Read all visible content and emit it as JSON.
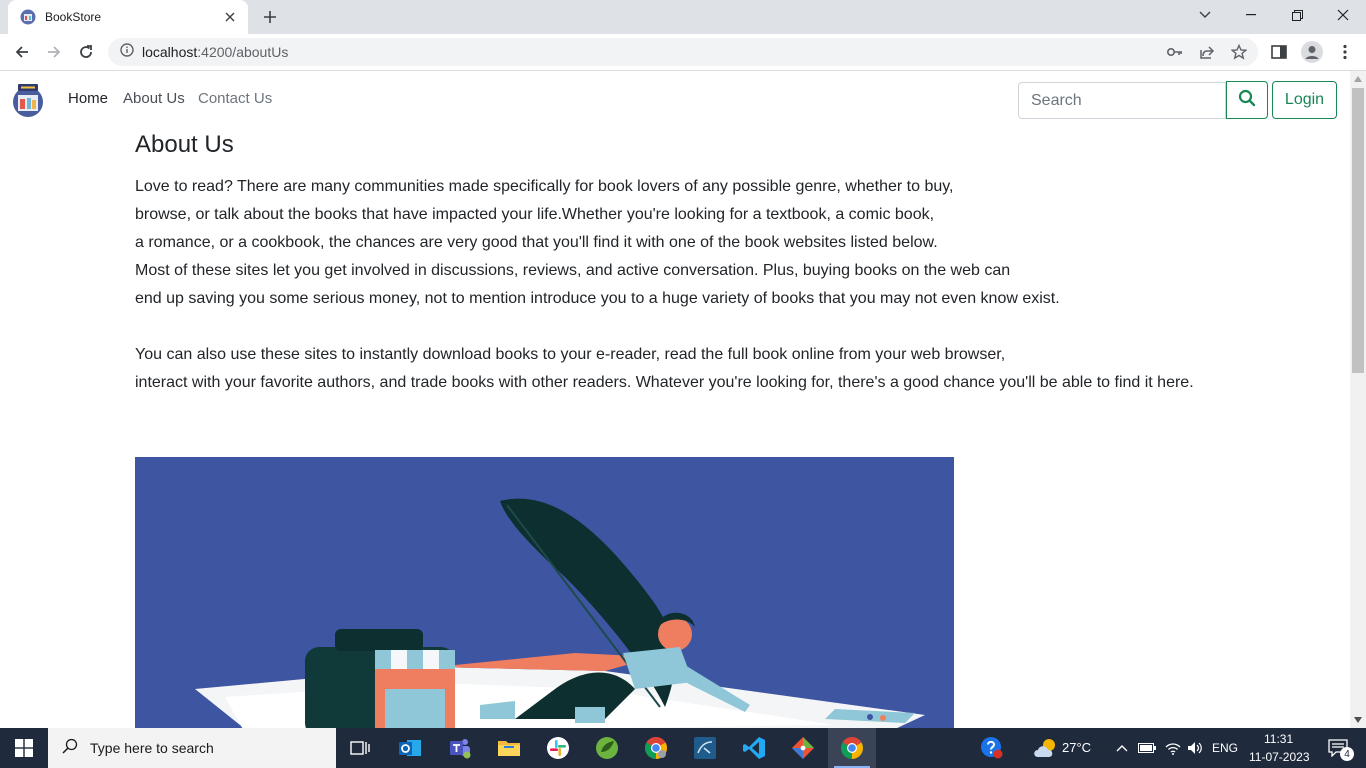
{
  "browser": {
    "tab_title": "BookStore",
    "url_host": "localhost",
    "url_path": ":4200/aboutUs"
  },
  "navbar": {
    "links": [
      {
        "label": "Home",
        "color": "#212529"
      },
      {
        "label": "About Us",
        "color": "#495057"
      },
      {
        "label": "Contact Us",
        "color": "#6c757d"
      }
    ],
    "search_placeholder": "Search",
    "login_label": "Login",
    "accent": "#198754"
  },
  "about": {
    "heading": "About Us",
    "paragraph1": [
      "Love to read? There are many communities made specifically for book lovers of any possible genre, whether to buy,",
      "browse, or talk about the books that have impacted your life.Whether you're looking for a textbook, a comic book,",
      "a romance, or a cookbook, the chances are very good that you'll find it with one of the book websites listed below.",
      "Most of these sites let you get involved in discussions, reviews, and active conversation. Plus, buying books on the web can",
      "end up saving you some serious money, not to mention introduce you to a huge variety of books that you may not even know exist."
    ],
    "paragraph2": [
      "You can also use these sites to instantly download books to your e-reader, read the full book online from your web browser,",
      "interact with your favorite authors, and trade books with other readers. Whatever you're looking for, there's a good chance you'll be able to find it here."
    ],
    "hero_bg": "#3e55a2"
  },
  "taskbar": {
    "search_placeholder": "Type here to search",
    "weather": "27°C",
    "language": "ENG",
    "time": "11:31",
    "date": "11-07-2023",
    "notifications": "4"
  }
}
